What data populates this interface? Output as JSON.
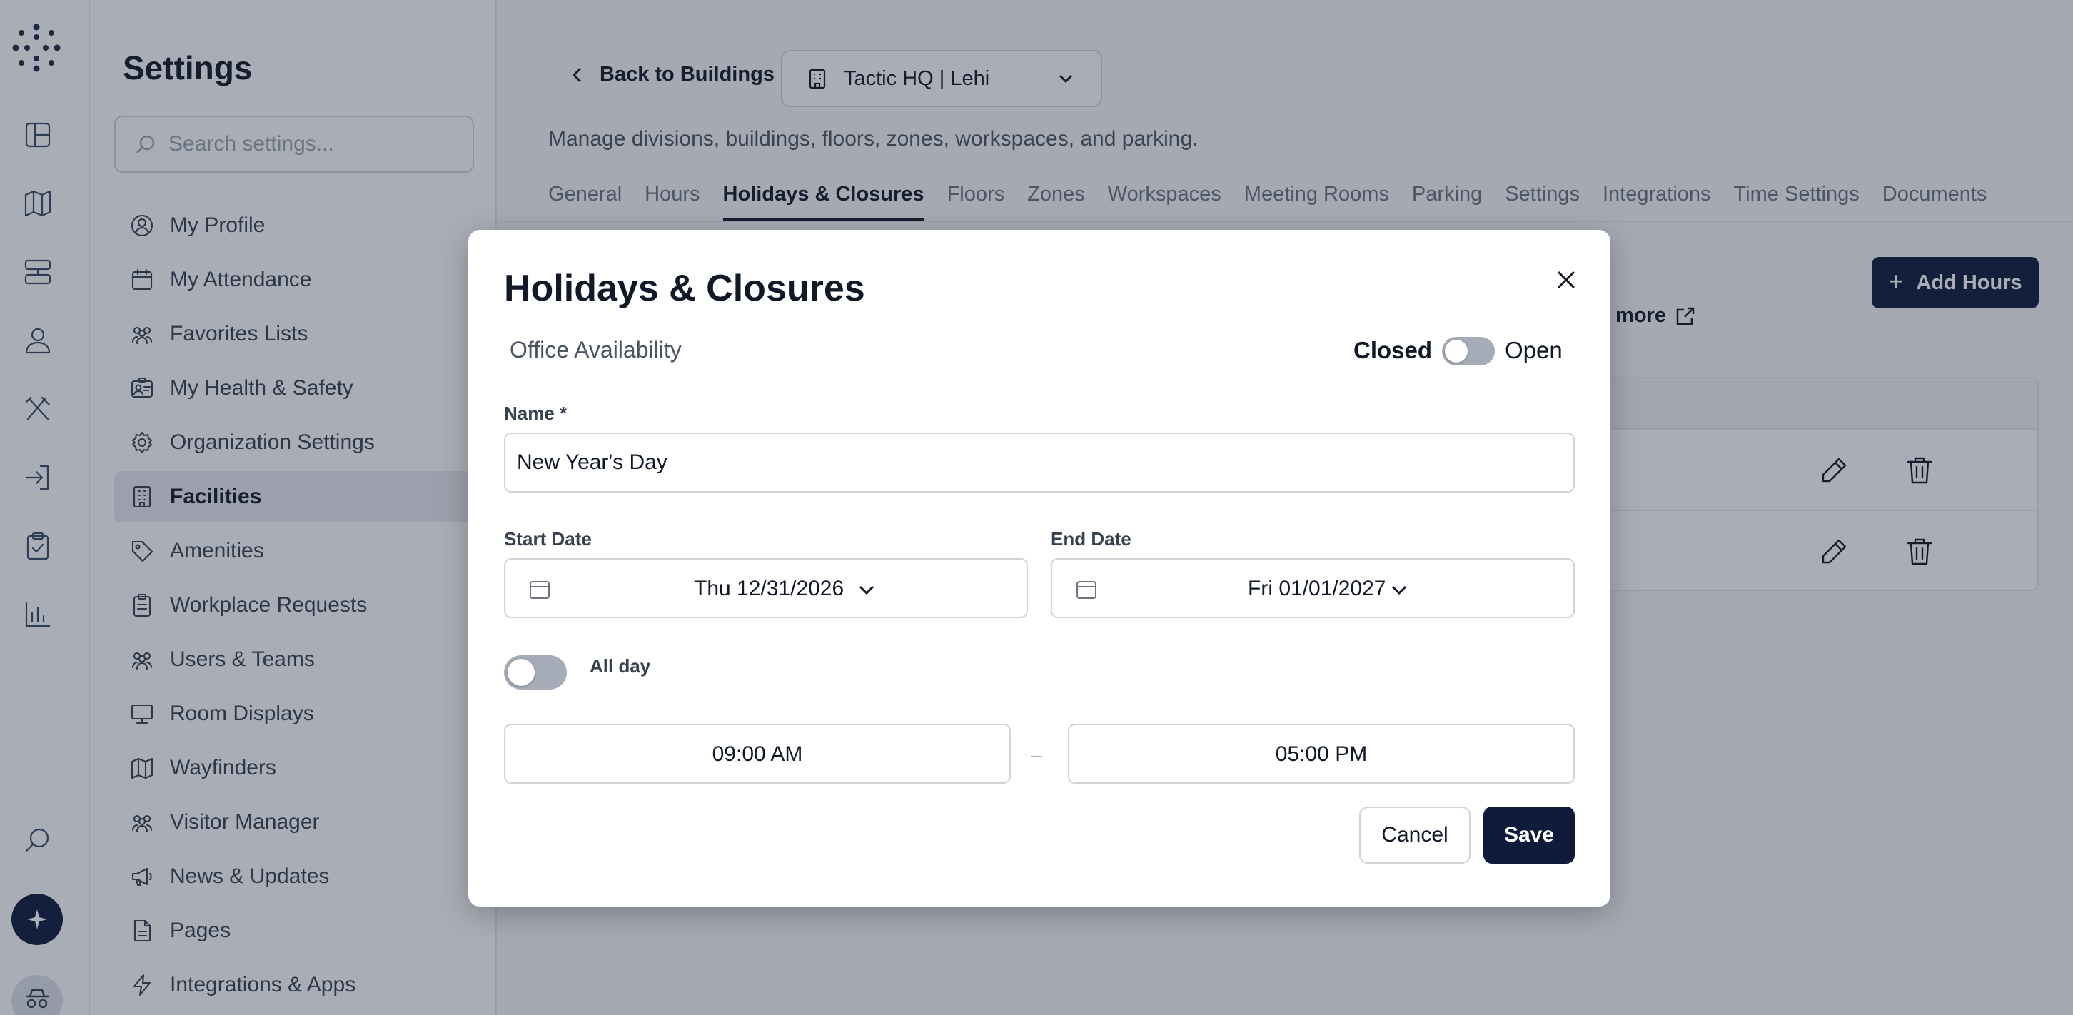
{
  "sidebar": {
    "title": "Settings",
    "search_placeholder": "Search settings...",
    "items": [
      {
        "label": "My Profile"
      },
      {
        "label": "My Attendance"
      },
      {
        "label": "Favorites Lists"
      },
      {
        "label": "My Health & Safety"
      },
      {
        "label": "Organization Settings"
      },
      {
        "label": "Facilities",
        "active": true
      },
      {
        "label": "Amenities"
      },
      {
        "label": "Workplace Requests"
      },
      {
        "label": "Users & Teams"
      },
      {
        "label": "Room Displays"
      },
      {
        "label": "Wayfinders"
      },
      {
        "label": "Visitor Manager"
      },
      {
        "label": "News & Updates"
      },
      {
        "label": "Pages"
      },
      {
        "label": "Integrations & Apps"
      }
    ]
  },
  "header": {
    "back_label": "Back to Buildings",
    "building": "Tactic HQ | Lehi",
    "description": "Manage divisions, buildings, floors, zones, workspaces, and parking."
  },
  "tabs": [
    {
      "label": "General"
    },
    {
      "label": "Hours"
    },
    {
      "label": "Holidays & Closures",
      "active": true
    },
    {
      "label": "Floors"
    },
    {
      "label": "Zones"
    },
    {
      "label": "Workspaces"
    },
    {
      "label": "Meeting Rooms"
    },
    {
      "label": "Parking"
    },
    {
      "label": "Settings"
    },
    {
      "label": "Integrations"
    },
    {
      "label": "Time Settings"
    },
    {
      "label": "Documents"
    }
  ],
  "content": {
    "add_hours_label": "Add Hours",
    "learn_more_label": "rn more"
  },
  "modal": {
    "title": "Holidays & Closures",
    "office_availability_label": "Office Availability",
    "closed_label": "Closed",
    "open_label": "Open",
    "name_label": "Name *",
    "name_value": "New Year's Day",
    "start_date_label": "Start Date",
    "start_date_value": "Thu 12/31/2026",
    "end_date_label": "End Date",
    "end_date_value": "Fri 01/01/2027",
    "all_day_label": "All day",
    "start_time": "09:00 AM",
    "end_time": "05:00 PM",
    "time_separator": "–",
    "cancel_label": "Cancel",
    "save_label": "Save"
  },
  "colors": {
    "primary": "#0f1b3d",
    "toggle_off": "#a5acb8",
    "overlay": "rgba(30,40,60,0.38)"
  }
}
